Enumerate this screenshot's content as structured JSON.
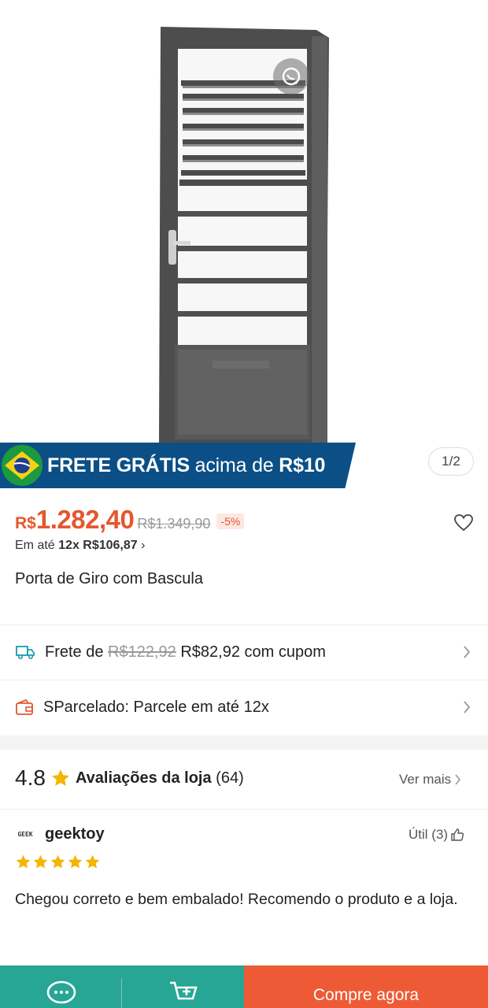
{
  "hero": {
    "promo_bold": "FRETE GRÁTIS",
    "promo_rest": " acima de ",
    "promo_amount": "R$10",
    "pager": "1/2"
  },
  "price": {
    "currency": "R$",
    "value": "1.282,40",
    "old": "R$1.349,90",
    "discount": "-5%",
    "install_prefix": "Em até ",
    "install_bold": "12x R$106,87",
    "install_arrow": "›"
  },
  "product": {
    "title": "Porta de Giro com Bascula"
  },
  "shipping": {
    "prefix": "Frete de ",
    "old": "R$122,92",
    "new": " R$82,92 com cupom"
  },
  "installment_service": {
    "label": "SParcelado: Parcele em até 12x"
  },
  "reviews": {
    "score": "4.8",
    "title_bold": "Avaliações da loja",
    "count": " (64)",
    "see_more": "Ver mais",
    "reviewer_avatar_text": "GEEK",
    "reviewer_name": "geektoy",
    "useful": "Útil (3)",
    "stars": 5,
    "comment": "Chegou correto e bem embalado! Recomendo o produto e a loja."
  },
  "bottom_bar": {
    "buy_label": "Compre agora"
  },
  "colors": {
    "accent": "#e4572e",
    "teal": "#27a696",
    "buy": "#ee5a35",
    "banner": "#0b4f86",
    "star": "#f5b400"
  },
  "icons": [
    "share-icon",
    "brazil-flag-icon",
    "heart-icon",
    "truck-icon",
    "wallet-icon",
    "chevron-right-icon",
    "star-icon",
    "thumbs-up-icon",
    "chat-icon",
    "add-to-cart-icon"
  ]
}
